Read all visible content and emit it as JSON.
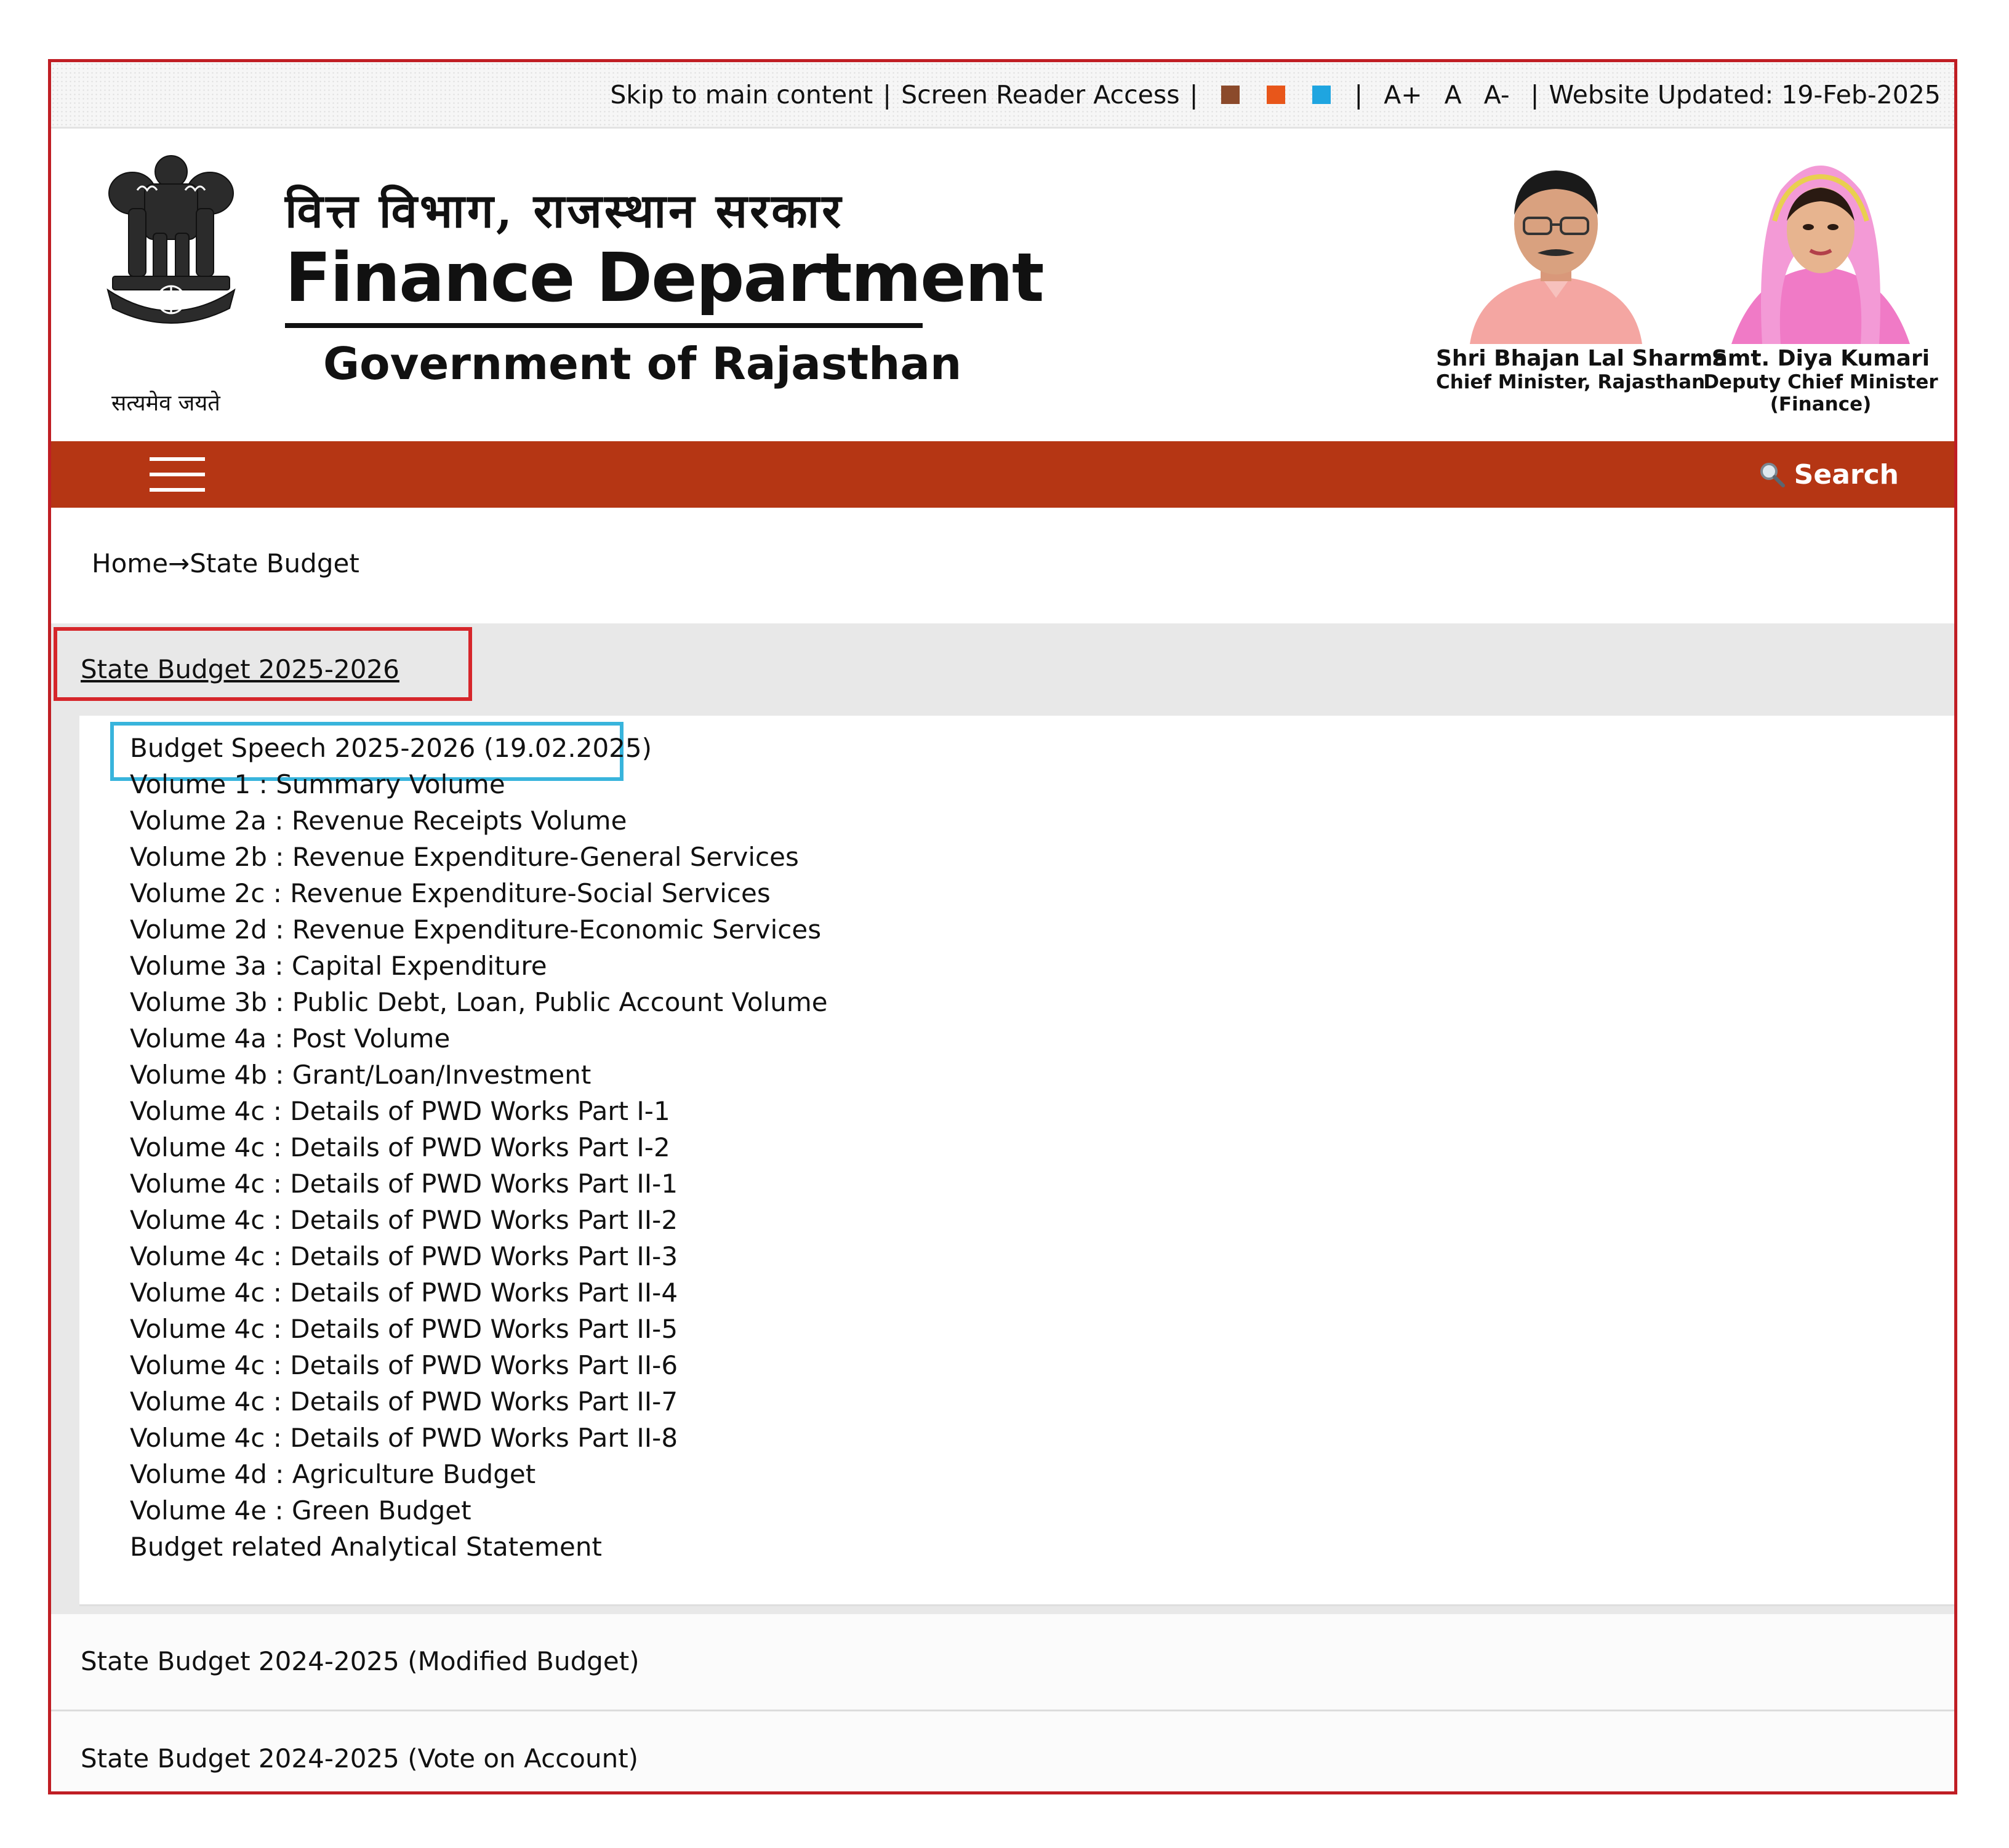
{
  "topbar": {
    "skip": "Skip to main content",
    "sep": "|",
    "screen_reader": "Screen Reader Access",
    "theme_colors": [
      "#8b4a2b",
      "#e8561a",
      "#1fa5e0"
    ],
    "font_increase": "A+",
    "font_normal": "A",
    "font_decrease": "A-",
    "updated": "Website Updated: 19-Feb-2025"
  },
  "header": {
    "motto": "सत्यमेव जयते",
    "hindi_title": "वित्त विभाग, राजस्थान सरकार",
    "title": "Finance Department",
    "subtitle": "Government of Rajasthan",
    "leaders": [
      {
        "name": "Shri Bhajan Lal Sharma",
        "designation": "Chief Minister, Rajasthan",
        "designation2": ""
      },
      {
        "name": "Smt. Diya Kumari",
        "designation": "Deputy Chief Minister",
        "designation2": "(Finance)"
      }
    ]
  },
  "nav": {
    "search_label": "Search",
    "nav_color": "#b53614"
  },
  "breadcrumb": "Home→State Budget",
  "accordion": {
    "open_section": {
      "title": "State Budget 2025-2026",
      "items": [
        "Budget Speech 2025-2026 (19.02.2025)",
        "Volume 1 : Summary Volume",
        "Volume 2a : Revenue Receipts Volume",
        "Volume 2b : Revenue Expenditure-General Services",
        "Volume 2c : Revenue Expenditure-Social Services",
        "Volume 2d : Revenue Expenditure-Economic Services",
        "Volume 3a : Capital Expenditure",
        "Volume 3b : Public Debt, Loan, Public Account Volume",
        "Volume 4a : Post Volume",
        "Volume 4b : Grant/Loan/Investment",
        "Volume 4c : Details of PWD Works Part I-1",
        "Volume 4c : Details of PWD Works Part I-2",
        "Volume 4c : Details of PWD Works Part II-1",
        "Volume 4c : Details of PWD Works Part II-2",
        "Volume 4c : Details of PWD Works Part II-3",
        "Volume 4c : Details of PWD Works Part II-4",
        "Volume 4c : Details of PWD Works Part II-5",
        "Volume 4c : Details of PWD Works Part II-6",
        "Volume 4c : Details of PWD Works Part II-7",
        "Volume 4c : Details of PWD Works Part II-8",
        "Volume 4d : Agriculture Budget",
        "Volume 4e : Green Budget",
        "Budget related Analytical Statement"
      ]
    },
    "other_sections": [
      "State Budget 2024-2025 (Modified Budget)",
      "State Budget 2024-2025 (Vote on Account)"
    ]
  },
  "annotations": {
    "red_box_color": "#d6262b",
    "cyan_box_color": "#38b4dc"
  }
}
